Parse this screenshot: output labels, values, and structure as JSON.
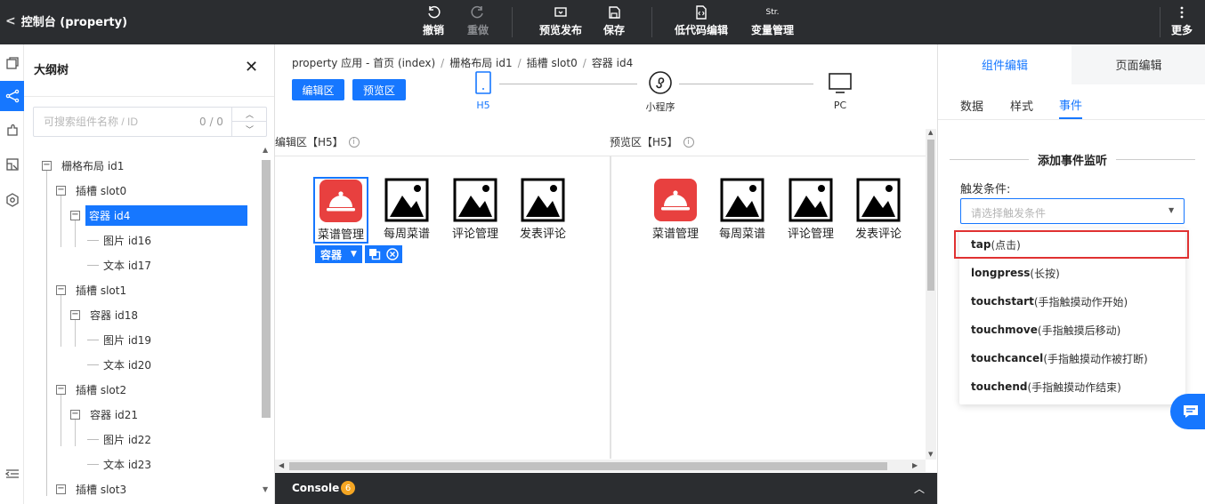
{
  "toolbar": {
    "back_label": "控制台 (property)",
    "undo": "撤销",
    "redo": "重做",
    "preview_publish": "预览发布",
    "save": "保存",
    "lowcode": "低代码编辑",
    "variables_icon_text": "Str.",
    "variables": "变量管理",
    "more": "更多"
  },
  "rail": {
    "items": [
      "pages-icon",
      "tree-icon",
      "component-icon",
      "datasource-icon",
      "settings-icon"
    ],
    "active": "tree-icon",
    "bottom": "collapse-icon"
  },
  "outline": {
    "title": "大纲树",
    "search_placeholder": "可搜索组件名称 / ID",
    "search_count": "0 / 0",
    "nodes": [
      {
        "label": "栅格布局 id1",
        "kind": "expand"
      },
      {
        "label": "插槽 slot0",
        "kind": "expand"
      },
      {
        "label": "容器 id4",
        "kind": "expand",
        "selected": true
      },
      {
        "label": "图片 id16",
        "kind": "leaf"
      },
      {
        "label": "文本 id17",
        "kind": "leaf"
      },
      {
        "label": "插槽 slot1",
        "kind": "expand"
      },
      {
        "label": "容器 id18",
        "kind": "expand"
      },
      {
        "label": "图片 id19",
        "kind": "leaf"
      },
      {
        "label": "文本 id20",
        "kind": "leaf"
      },
      {
        "label": "插槽 slot2",
        "kind": "expand"
      },
      {
        "label": "容器 id21",
        "kind": "expand"
      },
      {
        "label": "图片 id22",
        "kind": "leaf"
      },
      {
        "label": "文本 id23",
        "kind": "leaf"
      },
      {
        "label": "插槽 slot3",
        "kind": "expand"
      }
    ]
  },
  "center": {
    "breadcrumb": [
      "property 应用 - 首页 (index)",
      "栅格布局 id1",
      "插槽 slot0",
      "容器 id4"
    ],
    "edit_btn": "编辑区",
    "preview_btn": "预览区",
    "devices": [
      "H5",
      "小程序",
      "PC"
    ],
    "active_device": "H5",
    "edit_title": "编辑区【H5】",
    "preview_title": "预览区【H5】",
    "components": [
      "菜谱管理",
      "每周菜谱",
      "评论管理",
      "发表评论"
    ],
    "selected_component_label": "容器",
    "console_label": "Console",
    "console_badge": "6"
  },
  "right": {
    "tabs": [
      "组件编辑",
      "页面编辑"
    ],
    "subtabs": [
      "数据",
      "样式",
      "事件"
    ],
    "active_subtab": "事件",
    "section_title": "添加事件监听",
    "trigger_label": "触发条件:",
    "select_placeholder": "请选择触发条件",
    "options": [
      {
        "name": "tap",
        "desc": "(点击)"
      },
      {
        "name": "longpress",
        "desc": "(长按)"
      },
      {
        "name": "touchstart",
        "desc": "(手指触摸动作开始)"
      },
      {
        "name": "touchmove",
        "desc": "(手指触摸后移动)"
      },
      {
        "name": "touchcancel",
        "desc": "(手指触摸动作被打断)"
      },
      {
        "name": "touchend",
        "desc": "(手指触摸动作结束)"
      }
    ],
    "highlighted_option": "tap"
  },
  "colors": {
    "primary": "#1677ff",
    "toolbar_bg": "#2b2d30",
    "highlight_border": "#e03131",
    "icon_red": "#e8403f",
    "badge": "#f5a623"
  }
}
